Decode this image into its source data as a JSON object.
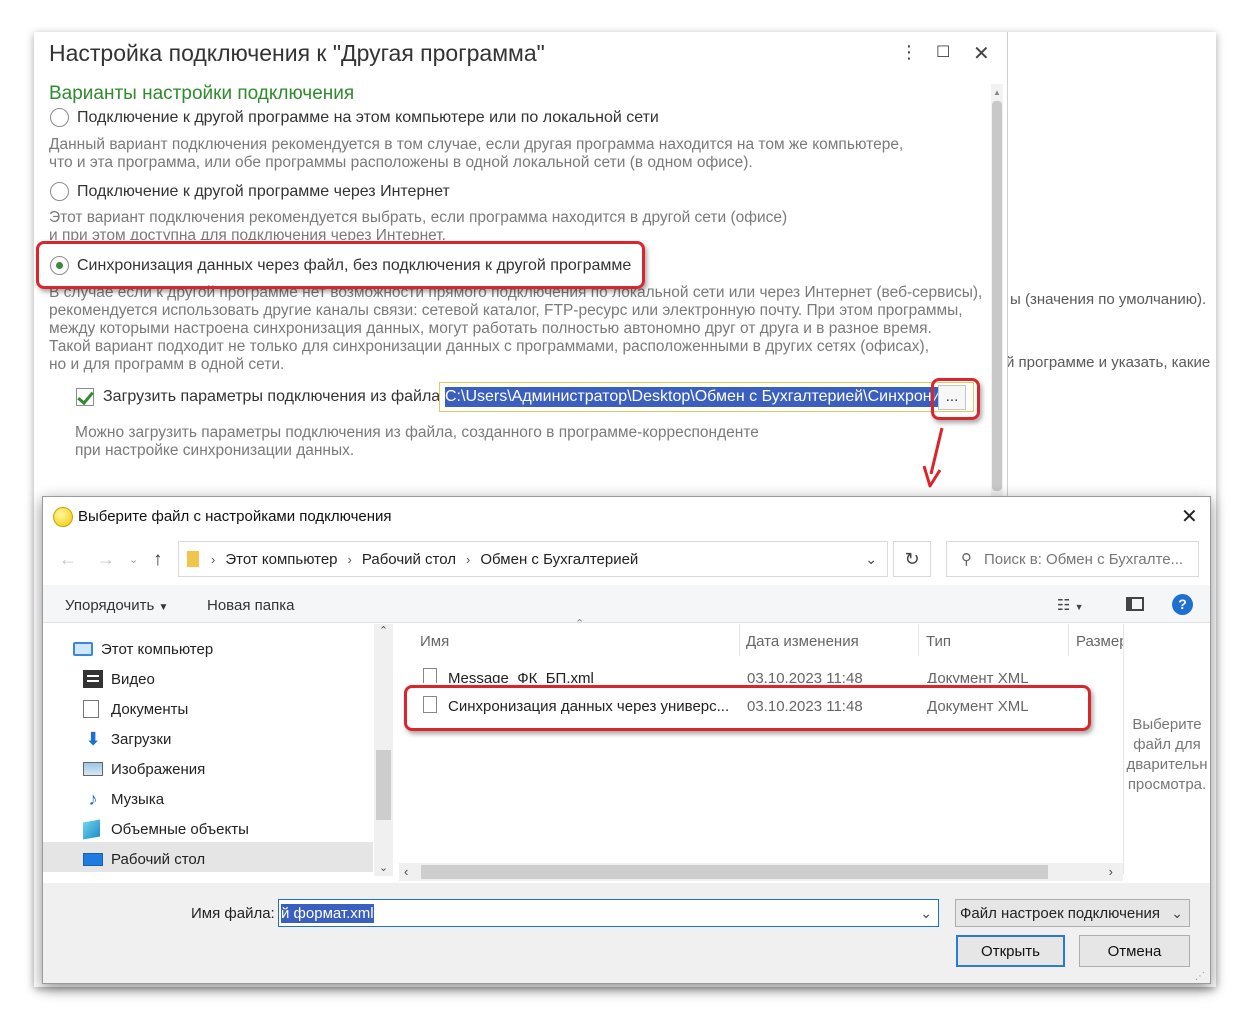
{
  "bg": {
    "line1": "ы (значения по умолчанию).",
    "line2": "й программе и указать, какие"
  },
  "main": {
    "title": "Настройка подключения к \"Другая программа\"",
    "section_title": "Варианты настройки подключения",
    "options": [
      {
        "label": "Подключение к другой программе на этом компьютере или по локальной сети",
        "desc": [
          "Данный вариант подключения рекомендуется в том случае, если другая программа находится на том же компьютере,",
          "что и эта программа, или обе программы расположены в одной локальной сети (в одном офисе)."
        ]
      },
      {
        "label": "Подключение к другой программе через Интернет",
        "desc": [
          "Этот вариант подключения рекомендуется выбрать, если программа находится в другой сети (офисе)",
          "и при этом доступна для подключения через Интернет."
        ]
      },
      {
        "label": "Синхронизация данных через файл, без подключения к другой программе",
        "desc": [
          "В случае если к другой программе нет возможности прямого подключения по локальной сети или через Интернет (веб-сервисы),",
          "рекомендуется использовать другие каналы связи: сетевой каталог, FTP-ресурс или электронную почту. При этом программы,",
          "между которыми настроена синхронизация данных, могут работать полностью автономно друг от друга и в разное время.",
          "Такой вариант подходит не только для синхронизации данных с программами, расположенными в других сетях (офисах),",
          "но и для программ в одной сети."
        ]
      }
    ],
    "selected_option": 2,
    "load_checkbox_label": "Загрузить параметры подключения из файла",
    "load_checkbox_checked": true,
    "path_value": "C:\\Users\\Администратор\\Desktop\\Обмен с Бухгалтерией\\Синхрони",
    "browse_label": "...",
    "load_hint": [
      "Можно загрузить параметры подключения из файла, созданного в программе-корреспонденте",
      "при настройке синхронизации данных."
    ]
  },
  "file_dialog": {
    "title": "Выберите файл с настройками подключения",
    "breadcrumb": [
      "Этот компьютер",
      "Рабочий стол",
      "Обмен с Бухгалтерией"
    ],
    "search_placeholder": "Поиск в: Обмен с Бухгалте...",
    "organize_label": "Упорядочить",
    "new_folder_label": "Новая папка",
    "nav_items": [
      {
        "label": "Этот компьютер",
        "icon": "computer-icon"
      },
      {
        "label": "Видео",
        "icon": "video-icon"
      },
      {
        "label": "Документы",
        "icon": "documents-icon"
      },
      {
        "label": "Загрузки",
        "icon": "downloads-icon"
      },
      {
        "label": "Изображения",
        "icon": "pictures-icon"
      },
      {
        "label": "Музыка",
        "icon": "music-icon"
      },
      {
        "label": "Объемные объекты",
        "icon": "3d-objects-icon"
      },
      {
        "label": "Рабочий стол",
        "icon": "desktop-icon"
      }
    ],
    "columns": {
      "name": "Имя",
      "date": "Дата изменения",
      "type": "Тип",
      "size": "Размер"
    },
    "files": [
      {
        "name": "Message_ФК_БП.xml",
        "date": "03.10.2023 11:48",
        "type": "Документ XML"
      },
      {
        "name": "Синхронизация данных через универс...",
        "date": "03.10.2023 11:48",
        "type": "Документ XML"
      }
    ],
    "preview_text": [
      "Выберите",
      "файл для",
      "дварительн",
      "просмотра."
    ],
    "filename_label": "Имя файла:",
    "filename_value": "й формат.xml",
    "filter_value": "Файл настроек подключения",
    "open_label": "Открыть",
    "cancel_label": "Отмена"
  },
  "colors": {
    "accent_green": "#2e8b2e",
    "highlight_red": "#d9262c",
    "selection_blue": "#3b5fbf"
  }
}
